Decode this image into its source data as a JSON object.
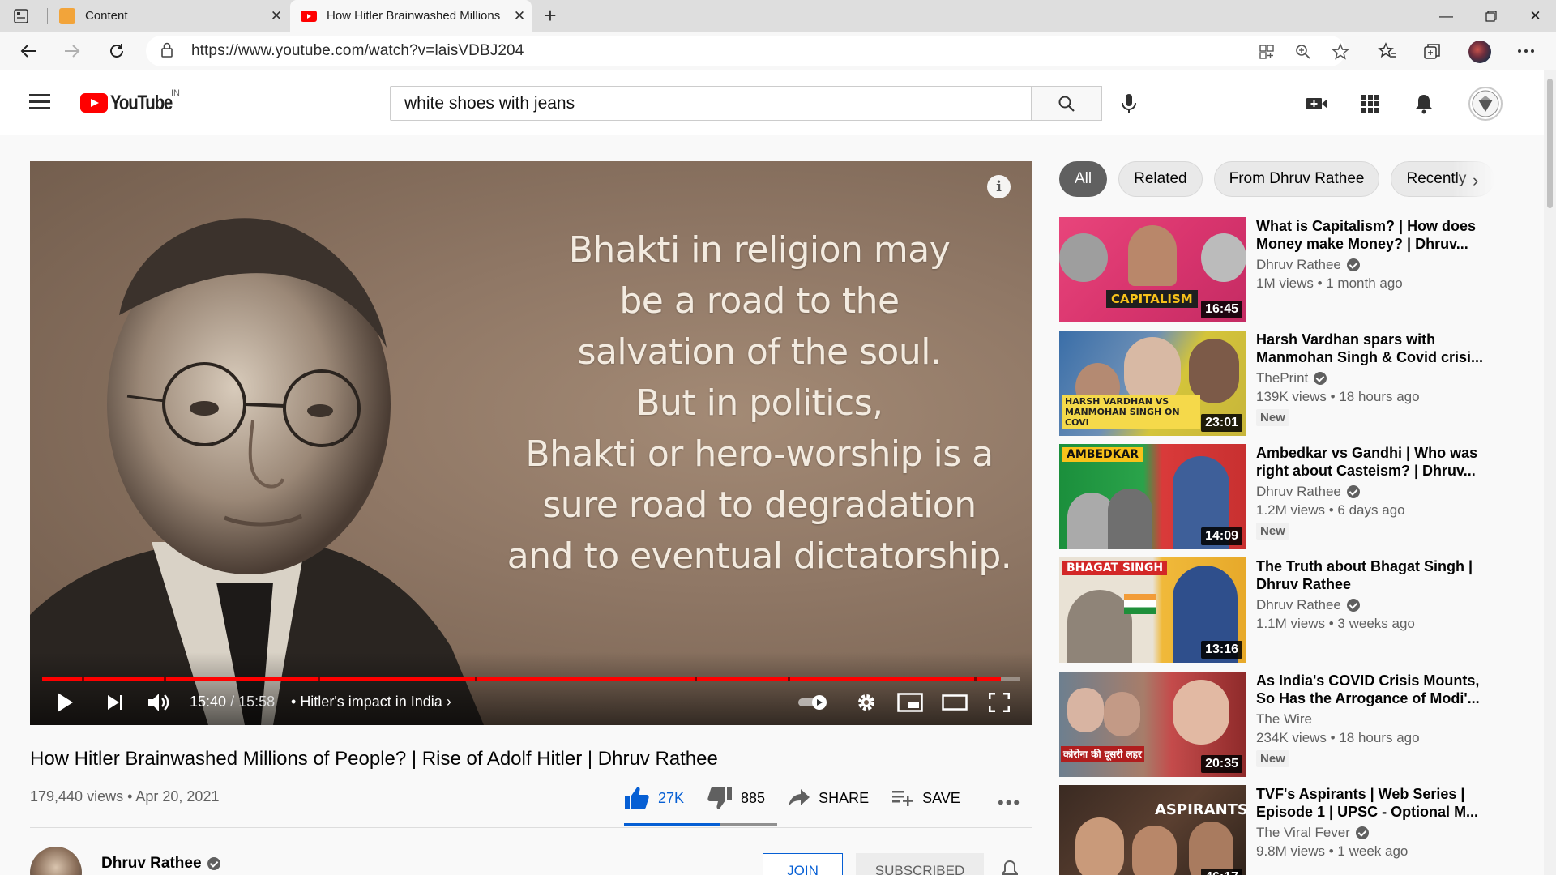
{
  "browser": {
    "tabs": [
      {
        "title": "Content",
        "active": false
      },
      {
        "title": "How Hitler Brainwashed Millions",
        "active": true
      }
    ],
    "url": "https://www.youtube.com/watch?v=laisVDBJ204"
  },
  "youtube": {
    "logo_text": "YouTube",
    "country_code": "IN",
    "search_value": "white shoes with jeans"
  },
  "player": {
    "quote_lines": [
      "Bhakti in religion may",
      "be a road to the",
      "salvation of the soul.",
      "But in politics,",
      "Bhakti or hero-worship is a",
      "sure road to degradation",
      "and to eventual dictatorship."
    ],
    "info_label": "i",
    "current_time": "15:40",
    "duration": "15:58",
    "chapter": "Hitler's impact in India",
    "progress": 0.98
  },
  "video": {
    "title": "How Hitler Brainwashed Millions of People? | Rise of Adolf Hitler | Dhruv Rathee",
    "views_date": "179,440 views • Apr 20, 2021",
    "likes": "27K",
    "dislikes": "885",
    "share_label": "SHARE",
    "save_label": "SAVE",
    "more_label": "•••",
    "channel_name": "Dhruv Rathee",
    "join_label": "JOIN",
    "subscribe_label": "SUBSCRIBED"
  },
  "sidebar": {
    "chips": [
      "All",
      "Related",
      "From Dhruv Rathee",
      "Recently"
    ],
    "recommendations": [
      {
        "title": "What is Capitalism? | How does Money make Money? | Dhruv...",
        "channel": "Dhruv Rathee",
        "meta": "1M views • 1 month ago",
        "duration": "16:45",
        "badge": "",
        "thumb_label": "CAPITALISM"
      },
      {
        "title": "Harsh Vardhan spars with Manmohan Singh & Covid crisi...",
        "channel": "ThePrint",
        "meta": "139K views • 18 hours ago",
        "duration": "23:01",
        "badge": "New",
        "thumb_label": "HARSH VARDHAN VS MANMOHAN SINGH ON COVI"
      },
      {
        "title": "Ambedkar vs Gandhi | Who was right about Casteism? | Dhruv...",
        "channel": "Dhruv Rathee",
        "meta": "1.2M views • 6 days ago",
        "duration": "14:09",
        "badge": "New",
        "thumb_label": "AMBEDKAR"
      },
      {
        "title": "The Truth about Bhagat Singh | Dhruv Rathee",
        "channel": "Dhruv Rathee",
        "meta": "1.1M views • 3 weeks ago",
        "duration": "13:16",
        "badge": "",
        "thumb_label": "BHAGAT SINGH"
      },
      {
        "title": "As India's COVID Crisis Mounts, So Has the Arrogance of Modi'...",
        "channel": "The Wire",
        "meta": "234K views • 18 hours ago",
        "duration": "20:35",
        "badge": "New",
        "thumb_label": "कोरोना की दूसरी लहर"
      },
      {
        "title": "TVF's Aspirants | Web Series | Episode 1 | UPSC - Optional M...",
        "channel": "The Viral Fever",
        "meta": "9.8M views • 1 week ago",
        "duration": "46:17",
        "badge": "",
        "thumb_label": "ASPIRANTS"
      }
    ]
  },
  "colors": {
    "youtube_red": "#ff0000",
    "link_blue": "#065fd4"
  }
}
